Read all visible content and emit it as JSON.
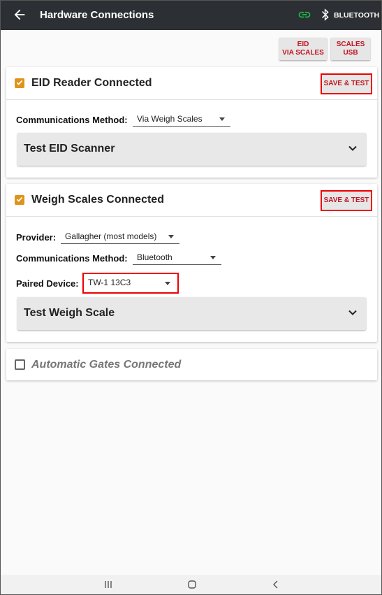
{
  "appbar": {
    "title": "Hardware Connections",
    "bluetooth_label": "BLUETOOTH",
    "link_color": "#19c24a"
  },
  "top_buttons": {
    "eid_via_scales": "EID\nVIA SCALES",
    "scales_usb": "SCALES\nUSB"
  },
  "eid_card": {
    "title": "EID Reader Connected",
    "checked": true,
    "save_test": "SAVE & TEST",
    "comm_label": "Communications Method:",
    "comm_value": "Via Weigh Scales",
    "test_label": "Test EID Scanner"
  },
  "scales_card": {
    "title": "Weigh Scales Connected",
    "checked": true,
    "save_test": "SAVE & TEST",
    "provider_label": "Provider:",
    "provider_value": "Gallagher (most models)",
    "comm_label": "Communications Method:",
    "comm_value": "Bluetooth",
    "paired_label": "Paired Device:",
    "paired_value": "TW-1 13C3",
    "test_label": "Test Weigh Scale"
  },
  "gates_card": {
    "title": "Automatic Gates Connected",
    "checked": false
  },
  "colors": {
    "accent": "#e0931a",
    "highlight": "#ee0000",
    "button_text": "#c1121f",
    "appbar_bg": "#2c2f33"
  }
}
